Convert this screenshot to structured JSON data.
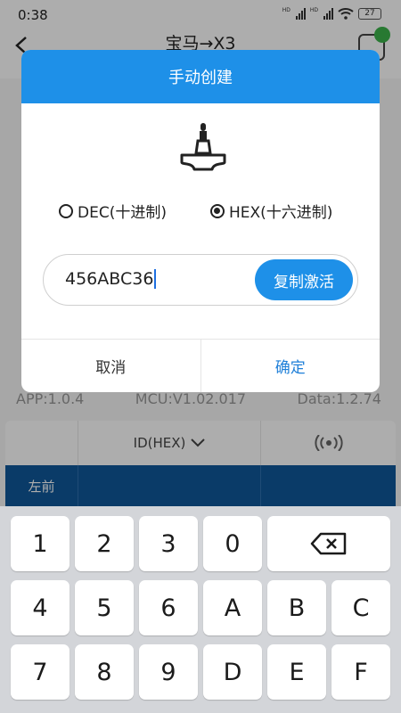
{
  "status_bar": {
    "time": "0:38",
    "hd_label": "HD",
    "battery": "27"
  },
  "app_bar": {
    "title": "宝马→X3"
  },
  "versions": {
    "app": "APP:1.0.4",
    "mcu": "MCU:V1.02.017",
    "data": "Data:1.2.74"
  },
  "table": {
    "column_header": "ID(HEX)",
    "row_label": "左前"
  },
  "dialog": {
    "title": "手动创建",
    "radio_dec": "DEC(十进制)",
    "radio_hex": "HEX(十六进制)",
    "selected_mode": "HEX",
    "input_value": "456ABC36",
    "activate_button": "复制激活",
    "cancel_button": "取消",
    "confirm_button": "确定"
  },
  "colors": {
    "accent": "#1e90e8",
    "table_row": "#10589a",
    "connected": "#3bb34a"
  },
  "keyboard": {
    "row1": [
      "1",
      "2",
      "3",
      "0"
    ],
    "row2": [
      "4",
      "5",
      "6",
      "A",
      "B",
      "C"
    ],
    "row3": [
      "7",
      "8",
      "9",
      "D",
      "E",
      "F"
    ],
    "backspace_icon": "backspace-icon"
  }
}
